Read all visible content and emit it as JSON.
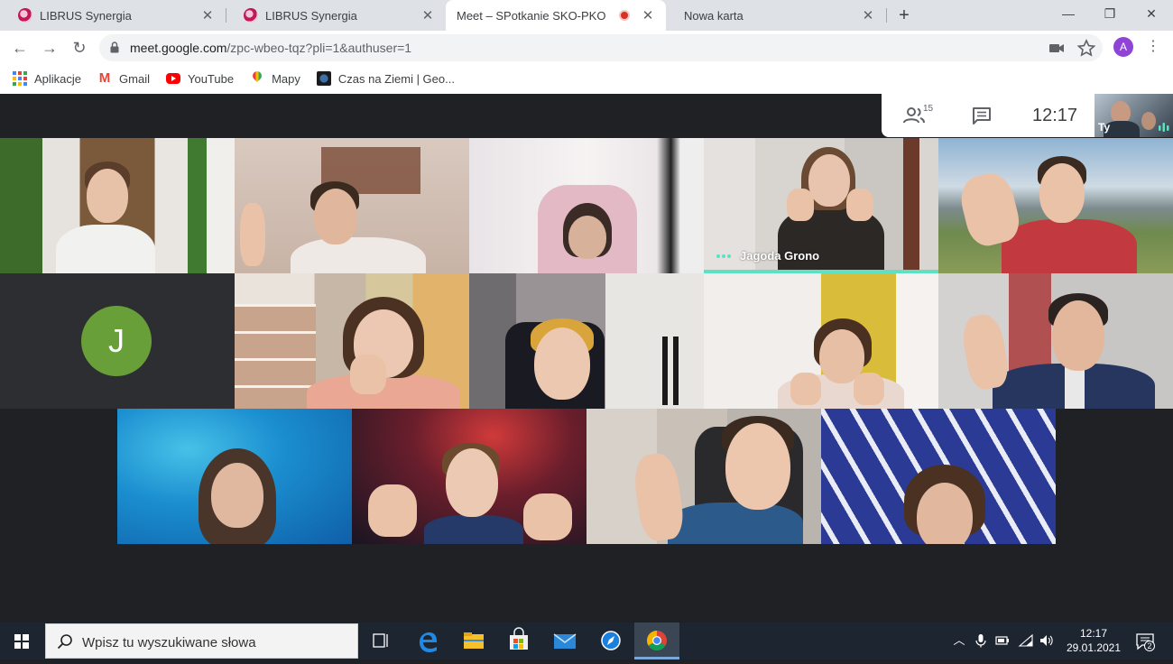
{
  "browser": {
    "tabs": [
      {
        "label": "LIBRUS Synergia",
        "icon": "librus-icon",
        "active": false
      },
      {
        "label": "LIBRUS Synergia",
        "icon": "librus-icon",
        "active": false
      },
      {
        "label": "Meet – SPotkanie SKO-PKO",
        "icon": "meet-icon",
        "active": true,
        "recording": true
      },
      {
        "label": "Nowa karta",
        "icon": "",
        "active": false
      }
    ],
    "close_glyph": "✕",
    "new_tab_glyph": "+",
    "window_controls": {
      "minimize": "—",
      "maximize": "❐",
      "close": "✕"
    },
    "nav": {
      "back": "←",
      "forward": "→",
      "reload": "↻"
    },
    "url_host": "meet.google.com",
    "url_path": "/zpc-wbeo-tqz?pli=1&authuser=1",
    "profile_initial": "A",
    "bookmarks": [
      {
        "label": "Aplikacje",
        "icon": "apps-grid-icon"
      },
      {
        "label": "Gmail",
        "icon": "gmail-icon"
      },
      {
        "label": "YouTube",
        "icon": "youtube-icon"
      },
      {
        "label": "Mapy",
        "icon": "maps-icon"
      },
      {
        "label": "Czas na Ziemi | Geo...",
        "icon": "earth-icon"
      }
    ]
  },
  "meet": {
    "participants_count": "15",
    "time": "12:17",
    "self_label": "Ty",
    "speaking_participant": "Jagoda Grono",
    "no_video_initial": "J",
    "colors": {
      "speaking": "#5ce1c3",
      "avatar_green": "#689f38",
      "background": "#202124"
    }
  },
  "taskbar": {
    "search_placeholder": "Wpisz tu wyszukiwane słowa",
    "time": "12:17",
    "date": "29.01.2021",
    "notification_count": "2",
    "apps": [
      "task-view-icon",
      "edge-icon",
      "file-explorer-icon",
      "store-icon",
      "mail-icon",
      "safari-like-icon",
      "chrome-icon"
    ]
  }
}
